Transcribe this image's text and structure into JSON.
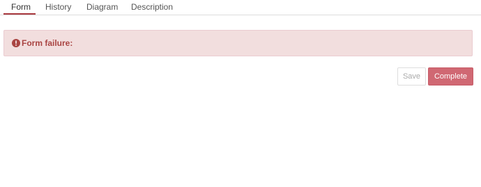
{
  "tabs": [
    {
      "label": "Form",
      "active": true
    },
    {
      "label": "History",
      "active": false
    },
    {
      "label": "Diagram",
      "active": false
    },
    {
      "label": "Description",
      "active": false
    }
  ],
  "alert": {
    "icon": "exclamation-circle-icon",
    "message": "Form failure:",
    "background": "#f2dede",
    "text_color": "#a94442"
  },
  "actions": {
    "save_label": "Save",
    "complete_label": "Complete",
    "complete_color": "#d06873"
  }
}
